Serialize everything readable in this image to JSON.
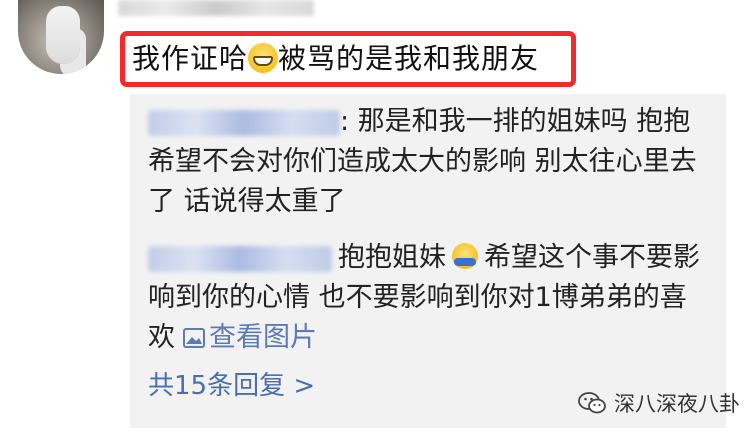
{
  "post": {
    "comment_text_before_emoji": "我作证哈",
    "comment_text_after_emoji": "被骂的是我和我朋友",
    "emoji_icon": "grinning-face-icon"
  },
  "replies": [
    {
      "text": ": 那是和我一排的姐妹吗 抱抱希望不会对你们造成太大的影响 别太往心里去了 话说得太重了"
    },
    {
      "text_before_emoji": "抱抱姐妹",
      "emoji_icon": "hugging-face-icon",
      "text_after_emoji": "希望这个事不要影响到你的心情 也不要影响到你对1博弟弟的喜欢",
      "view_picture_label": "查看图片",
      "picture_icon": "image-icon"
    }
  ],
  "reply_count_label": "共15条回复 >",
  "watermark": {
    "icon": "wechat-icon",
    "text": "深八深夜八卦"
  },
  "colors": {
    "highlight": "#f22a2a",
    "link": "#4b6eaf",
    "reply_bg": "#f2f2f2"
  }
}
